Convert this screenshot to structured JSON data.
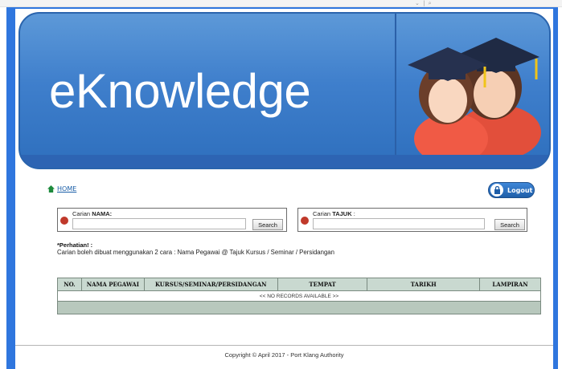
{
  "browser": {
    "controls": "⌄ | ⌕"
  },
  "banner": {
    "title": "eKnowledge"
  },
  "nav": {
    "home": "HOME",
    "logout": "Logout"
  },
  "search_name": {
    "label_prefix": "Carian ",
    "label_bold": "NAMA:",
    "value": "",
    "button": "Search"
  },
  "search_topic": {
    "label_prefix": "Carian ",
    "label_bold": "TAJUK",
    "label_suffix": " :",
    "value": "",
    "button": "Search"
  },
  "notice": {
    "title": "*Perhatian! :",
    "text": "Carian boleh dibuat menggunakan 2 cara : Nama Pegawai @ Tajuk Kursus / Seminar / Persidangan"
  },
  "table": {
    "columns": [
      "NO.",
      "NAMA PEGAWAI",
      "KURSUS/SEMINAR/PERSIDANGAN",
      "TEMPAT",
      "TARIKH",
      "LAMPIRAN"
    ],
    "empty_message": "<< NO RECORDS AVAILABLE >>"
  },
  "footer": {
    "copyright": "Copyright © April 2017 - Port Klang Authority"
  },
  "colors": {
    "frame": "#2f76de",
    "banner": "#3f7fcc",
    "header_row": "#c9d9d0",
    "alert_dot": "#c0392b"
  }
}
